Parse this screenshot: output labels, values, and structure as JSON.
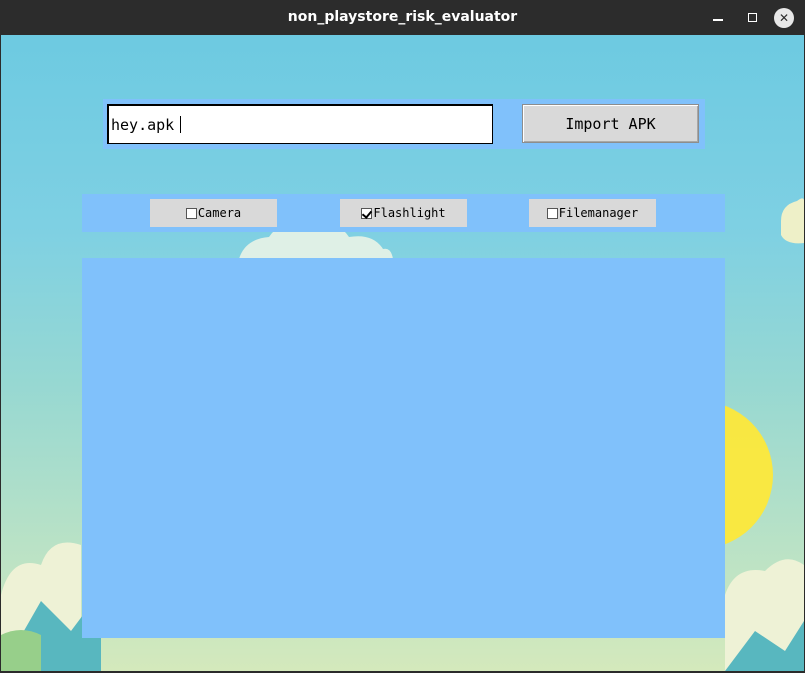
{
  "window": {
    "title": "non_playstore_risk_evaluator",
    "minimize_glyph": "—",
    "maximize_glyph": "□",
    "close_glyph": "✕"
  },
  "apk_input": {
    "value": "hey.apk"
  },
  "import_button": {
    "label": "Import APK"
  },
  "permissions": [
    {
      "label": "Camera",
      "checked": false
    },
    {
      "label": "Flashlight",
      "checked": true
    },
    {
      "label": "Filemanager",
      "checked": false
    }
  ],
  "colors": {
    "panel": "#80c1fb",
    "button": "#d9d9d9",
    "titlebar": "#2c2c2c"
  }
}
